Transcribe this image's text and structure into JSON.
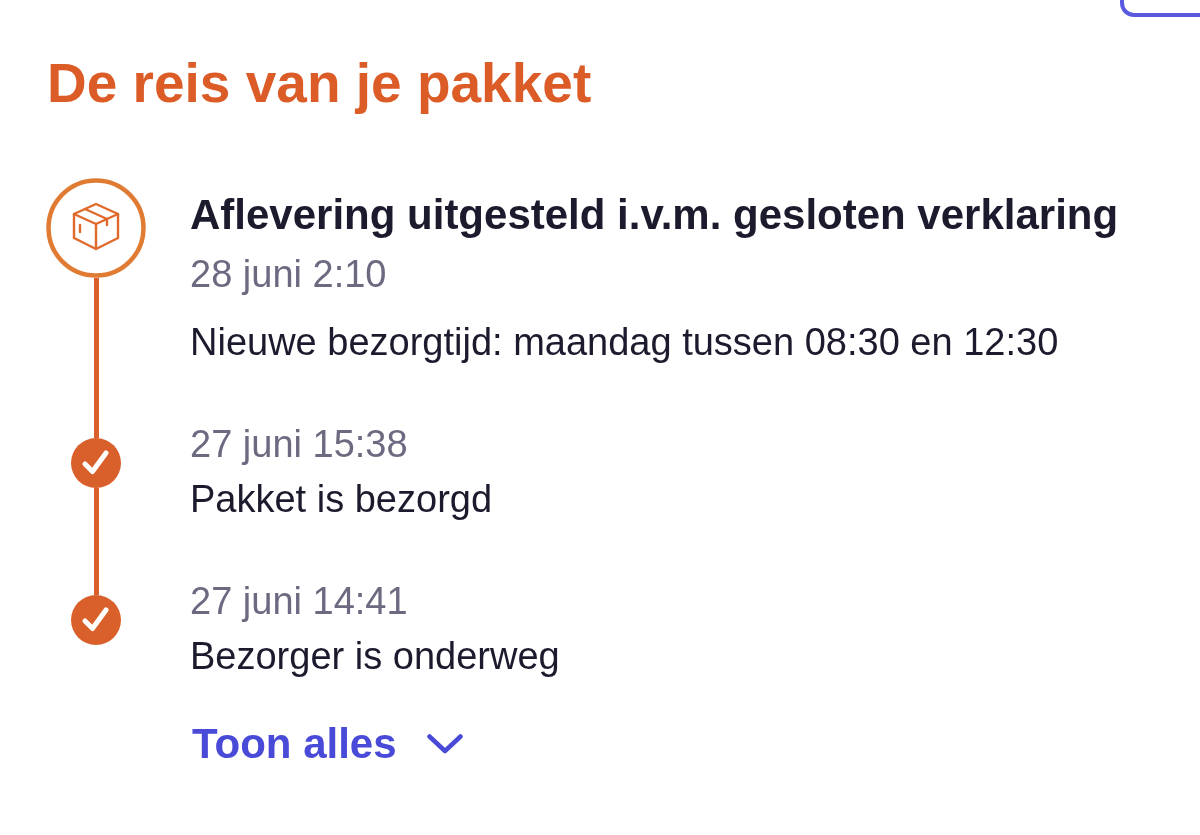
{
  "title": "De reis van je pakket",
  "events": [
    {
      "kind": "current",
      "title": "Aflevering uitgesteld i.v.m. gesloten verklaring",
      "time": "28 juni 2:10",
      "description": "Nieuwe bezorgtijd: maandag tussen 08:30 en 12:30"
    },
    {
      "kind": "done",
      "time": "27 juni 15:38",
      "description": "Pakket is bezorgd"
    },
    {
      "kind": "done",
      "time": "27 juni 14:41",
      "description": "Bezorger is onderweg"
    }
  ],
  "show_all": {
    "label": "Toon alles",
    "expanded": false
  }
}
